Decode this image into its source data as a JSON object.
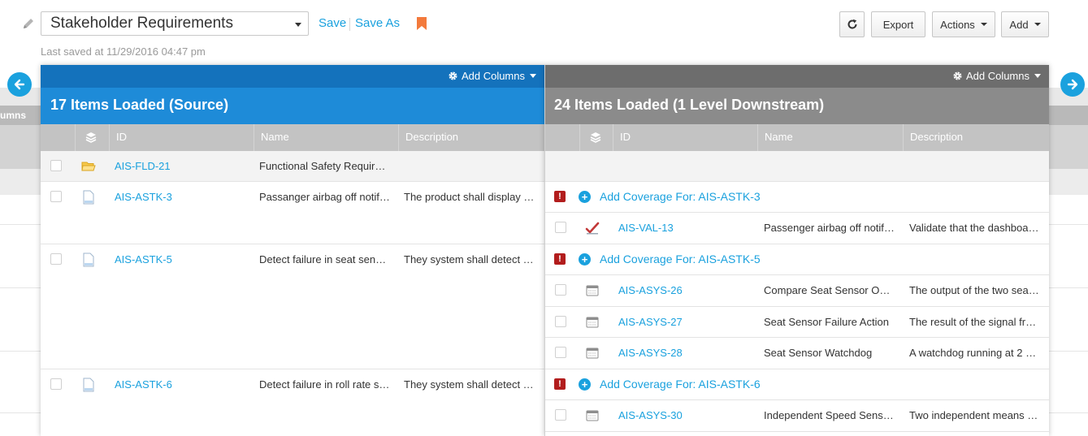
{
  "toolbar": {
    "report_name": "Stakeholder Requirements",
    "save_label": "Save",
    "save_as_label": "Save As",
    "last_saved": "Last saved at 11/29/2016 04:47 pm",
    "export_label": "Export",
    "actions_label": "Actions",
    "add_label": "Add"
  },
  "ghost": {
    "label": "umns"
  },
  "source": {
    "add_columns": "Add Columns",
    "title": "17 Items Loaded (Source)",
    "columns": [
      "ID",
      "Name",
      "Description"
    ],
    "rows": [
      {
        "id": "AIS-FLD-21",
        "name": "Functional Safety Requir…",
        "description": "",
        "type": "folder"
      },
      {
        "id": "AIS-ASTK-3",
        "name": "Passanger airbag off notif…",
        "description": "The product shall display …",
        "type": "document"
      },
      {
        "id": "AIS-ASTK-5",
        "name": "Detect failure in seat sen…",
        "description": "They system shall detect …",
        "type": "document"
      },
      {
        "id": "AIS-ASTK-6",
        "name": "Detect failure in roll rate s…",
        "description": "They system shall detect …",
        "type": "document"
      }
    ]
  },
  "target": {
    "add_columns": "Add Columns",
    "title": "24 Items Loaded (1 Level Downstream)",
    "columns": [
      "ID",
      "Name",
      "Description"
    ],
    "coverage": [
      "Add Coverage For: AIS-ASTK-3",
      "Add Coverage For: AIS-ASTK-5",
      "Add Coverage For: AIS-ASTK-6"
    ],
    "rows": [
      {
        "id": "AIS-VAL-13",
        "name": "Passenger airbag off notif…",
        "description": "Validate that the dashboa…",
        "type": "validation"
      },
      {
        "id": "AIS-ASYS-26",
        "name": "Compare Seat Sensor O…",
        "description": "The output of the two sea…",
        "type": "requirement"
      },
      {
        "id": "AIS-ASYS-27",
        "name": "Seat Sensor Failure Action",
        "description": "The result of the signal fr…",
        "type": "requirement"
      },
      {
        "id": "AIS-ASYS-28",
        "name": "Seat Sensor Watchdog",
        "description": "A watchdog running at 2 …",
        "type": "requirement"
      },
      {
        "id": "AIS-ASYS-30",
        "name": "Independent Speed Sens…",
        "description": "Two independent means …",
        "type": "requirement"
      }
    ]
  },
  "colors": {
    "accent": "#1aa1de",
    "source_header": "#1e8bd8",
    "target_header": "#8b8b8b",
    "alert": "#b21d1d",
    "bookmark": "#f37a3c"
  },
  "icons": [
    "pencil-icon",
    "bookmark-icon",
    "refresh-icon",
    "arrow-left-icon",
    "arrow-right-icon",
    "gear-icon",
    "folder-icon",
    "document-icon",
    "checkmark-icon",
    "table-icon",
    "alert-icon",
    "plus-circle-icon"
  ]
}
